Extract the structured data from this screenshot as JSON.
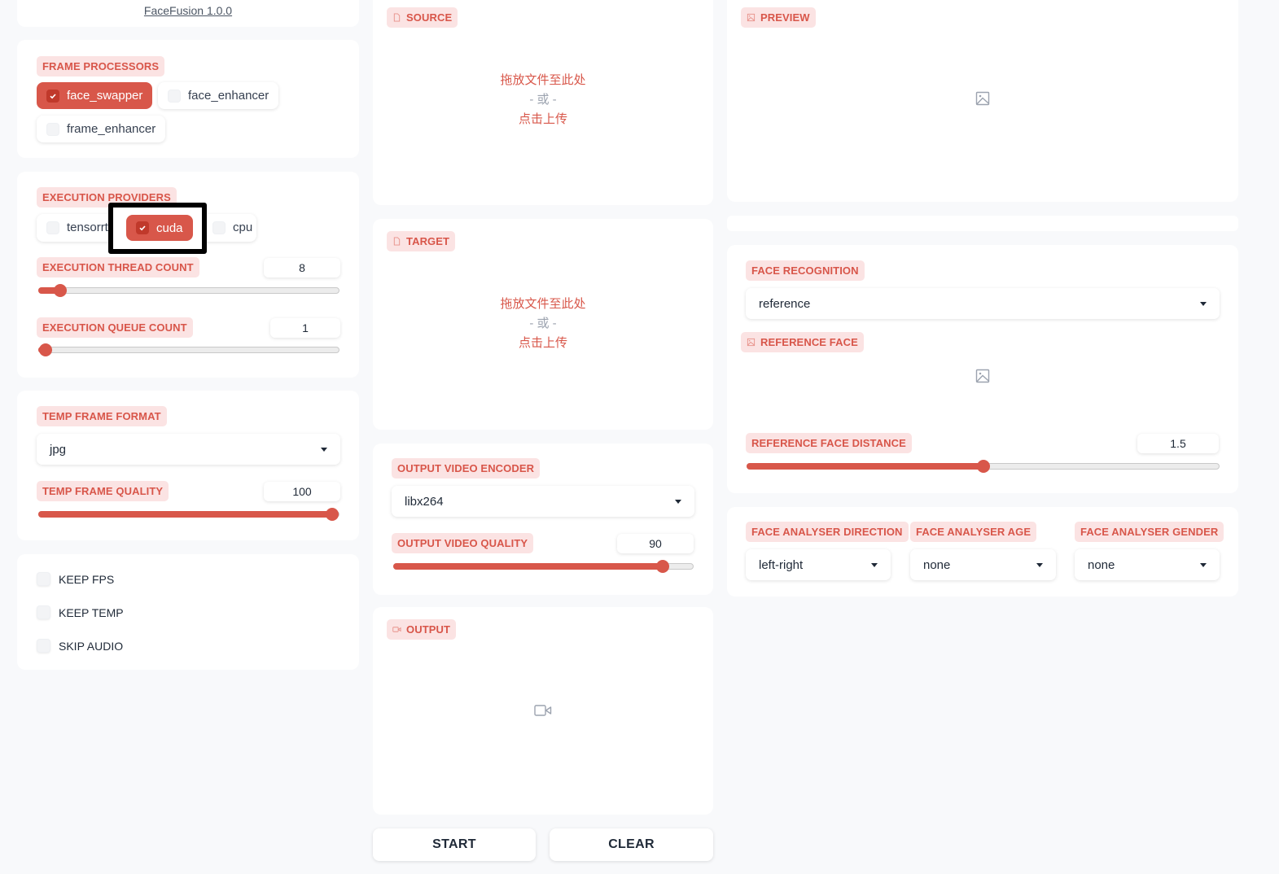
{
  "app": {
    "title": "FaceFusion 1.0.0"
  },
  "frame_processors": {
    "label": "FRAME PROCESSORS",
    "options": [
      {
        "label": "face_swapper",
        "checked": true
      },
      {
        "label": "face_enhancer",
        "checked": false
      },
      {
        "label": "frame_enhancer",
        "checked": false
      }
    ]
  },
  "execution_providers": {
    "label": "EXECUTION PROVIDERS",
    "options": [
      {
        "label": "tensorrt",
        "checked": false
      },
      {
        "label": "cuda",
        "checked": true
      },
      {
        "label": "cpu",
        "checked": false
      }
    ]
  },
  "execution_thread_count": {
    "label": "EXECUTION THREAD COUNT",
    "value": "8",
    "fraction": 0.07
  },
  "execution_queue_count": {
    "label": "EXECUTION QUEUE COUNT",
    "value": "1",
    "fraction": 0.0
  },
  "temp_frame_format": {
    "label": "TEMP FRAME FORMAT",
    "value": "jpg"
  },
  "temp_frame_quality": {
    "label": "TEMP FRAME QUALITY",
    "value": "100",
    "fraction": 1.0
  },
  "toggles": [
    {
      "label": "KEEP FPS",
      "checked": false
    },
    {
      "label": "KEEP TEMP",
      "checked": false
    },
    {
      "label": "SKIP AUDIO",
      "checked": false
    }
  ],
  "source": {
    "label": "SOURCE",
    "drop_text": "拖放文件至此处",
    "or_text": "- 或 -",
    "click_text": "点击上传"
  },
  "target": {
    "label": "TARGET",
    "drop_text": "拖放文件至此处",
    "or_text": "- 或 -",
    "click_text": "点击上传"
  },
  "output_video_encoder": {
    "label": "OUTPUT VIDEO ENCODER",
    "value": "libx264"
  },
  "output_video_quality": {
    "label": "OUTPUT VIDEO QUALITY",
    "value": "90",
    "fraction": 0.9
  },
  "output": {
    "label": "OUTPUT"
  },
  "actions": {
    "start": "START",
    "clear": "CLEAR"
  },
  "preview": {
    "label": "PREVIEW"
  },
  "face_recognition": {
    "label": "FACE RECOGNITION",
    "value": "reference"
  },
  "reference_face": {
    "label": "REFERENCE FACE"
  },
  "reference_face_distance": {
    "label": "REFERENCE FACE DISTANCE",
    "value": "1.5",
    "fraction": 0.5
  },
  "face_analyser": {
    "direction": {
      "label": "FACE ANALYSER DIRECTION",
      "value": "left-right"
    },
    "age": {
      "label": "FACE ANALYSER AGE",
      "value": "none"
    },
    "gender": {
      "label": "FACE ANALYSER GENDER",
      "value": "none"
    }
  },
  "colors": {
    "accent": "#d8574a",
    "badge_bg": "#fbe3e3",
    "page_bg": "#f8f9fb"
  }
}
